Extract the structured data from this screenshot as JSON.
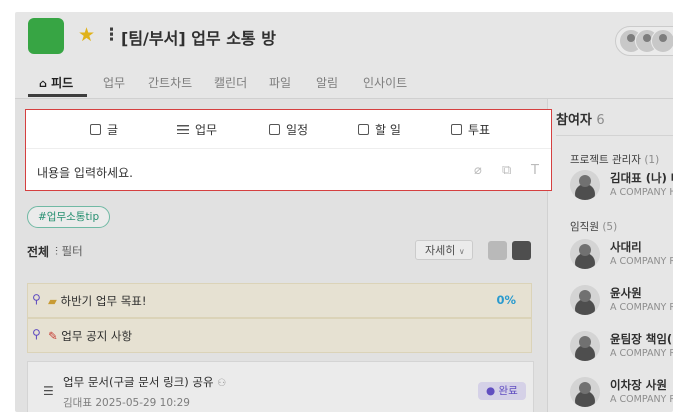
{
  "header": {
    "title": "[팀/부서] 업무 소통 방",
    "project_color": "#3cb34a",
    "star_icon": "star-icon",
    "menu_icon": "kebab-icon"
  },
  "tabs": [
    {
      "label": "피드",
      "active": true
    },
    {
      "label": "업무"
    },
    {
      "label": "간트차트"
    },
    {
      "label": "캘린더"
    },
    {
      "label": "파일"
    },
    {
      "label": "알림"
    },
    {
      "label": "인사이트"
    }
  ],
  "composer": {
    "types": [
      {
        "label": "글",
        "icon": "text-icon"
      },
      {
        "label": "업무",
        "icon": "list-icon"
      },
      {
        "label": "일정",
        "icon": "calendar-icon"
      },
      {
        "label": "할 일",
        "icon": "checkbox-icon"
      },
      {
        "label": "투표",
        "icon": "vote-icon"
      }
    ],
    "placeholder": "내용을 입력하세요."
  },
  "hashtag_chip": "#업무소통tip",
  "feed_filter": {
    "all_label": "전체",
    "filter_label": "필터",
    "view_select": "자세히"
  },
  "pinned": [
    {
      "text": "하반기 업무 목표!",
      "percent": "0%"
    },
    {
      "text": "업무 공지 사항"
    }
  ],
  "post": {
    "title": "업무 문서(구글 문서 링크) 공유",
    "author": "김대표",
    "datetime": "2025-05-29 10:29",
    "status": "완료"
  },
  "sidebar": {
    "title": "참여자",
    "count": "6",
    "managers_label": "프로젝트 관리자",
    "managers_count": "(1)",
    "members_label": "임직원",
    "members_count": "(5)",
    "people": [
      {
        "name": "김대표 (나) 대",
        "company": "A COMPANY  H"
      },
      {
        "name": "사대리",
        "company": "A COMPANY  R"
      },
      {
        "name": "윤사원",
        "company": "A COMPANY  R"
      },
      {
        "name": "윤팀장 책임(2",
        "company": "A COMPANY  R"
      },
      {
        "name": "이차장 사원",
        "company": "A COMPANY  R"
      }
    ]
  },
  "colors": {
    "highlight": "#d54040",
    "accent_blue": "#2ea8e0",
    "status_purple": "#6a55d1"
  }
}
